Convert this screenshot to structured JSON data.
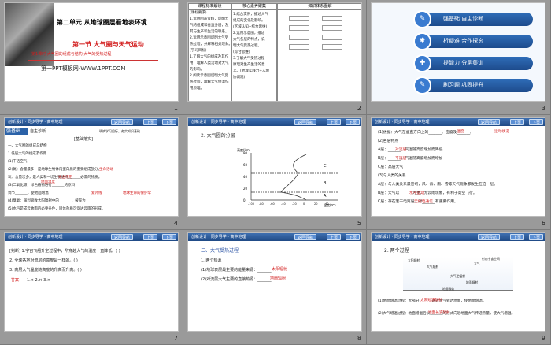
{
  "header": {
    "book": "创新设计 · 同步导学 · 高中地理",
    "nav": [
      "返回导航",
      "上页",
      "下页"
    ]
  },
  "slides": [
    {
      "num": "1",
      "unit": "第二单元  从地球圈层看地表环境",
      "section": "第一节  大气圈与天气运动",
      "lesson": "第1课时  大气圈的组成与结构  大气的受热过程",
      "site": "第一PPT模板网-WWW.1PPT.COM"
    },
    {
      "num": "2",
      "cols": [
        "课程标准解读",
        "核心素养聚集",
        "知识体系图解"
      ],
      "text1": [
        "(课标要求)",
        "1.运用图表资料，说明大",
        "气的组成和垂直分层，及",
        "其与生产和生活的联系。",
        "2.运用示意图说明大气受",
        "热过程，并解释相关现象。",
        "(学习目标)",
        "1.了解大气的组成及其作",
        "用，理解人类活动对大气",
        "的影响。",
        "2.阅读示意图说明大气受",
        "热过程，理解大气保温作",
        "用原理。"
      ],
      "text2": [
        "1.结合实例，描述大气",
        "组成的变化及影响。",
        "(区域认知+综合思维)",
        "2.运用示意图，描述",
        "大气各层的特点，说",
        "明大气受热过程。",
        "(综合思维)",
        "3.了解大气受热过程",
        "原理对生产生活的意",
        "义。(地理实践力+人地",
        "协调观)"
      ]
    },
    {
      "num": "3",
      "items": [
        "强基础 自主诊断",
        "析疑难 合作探究",
        "提能力 分层集训",
        "刷习题 巩固提升"
      ]
    },
    {
      "num": "4",
      "label": "强基础",
      "sub": "自主诊断",
      "note": "明辨学习目标，夯实知识基础",
      "heading": "[基础落实]",
      "lines": [
        "一、大气圈的组成与结构",
        "1.低层大气的组成及作用",
        "(1)干洁空气",
        "(2)氮：含量最多，是地球生物体内蛋白质的重要组成部分。",
        "氧：含量次多，是人类和一切生物维持_______必需的物质。",
        "(3)二氧化碳：绿色植物进行_______的原料",
        "     调节_______，使地面增温",
        "(4)臭氧：强烈吸收太阳辐射中的_______，被誉为_______",
        "(5)水汽是成云致雨的必要条件，固体杂质可促进云雨的形成。"
      ],
      "blanks": [
        "生命活动",
        "光合作用",
        "地面温度",
        "紫外线",
        "地球生命的保护伞"
      ]
    },
    {
      "num": "5",
      "title": "2. 大气圈的分层",
      "yl": "高度(km)",
      "xl": "温度(℃)",
      "labels": [
        "C",
        "B",
        "A"
      ],
      "yt": [
        "80",
        "60",
        "40",
        "20",
        "0"
      ],
      "xt": [
        "-100",
        "-80",
        "-60",
        "-40",
        "-20",
        "0",
        "20",
        "40"
      ]
    },
    {
      "num": "6",
      "lines": [
        "(1)依据：大气在垂直方向上的_______、密度及_______。",
        "(2)各层特点",
        "A层：_______，气温随高度增加而降低",
        "B层：_______，气温随高度增加而增加",
        "C层：高层大气",
        "(3)与人类的关系",
        "A层：与人类关系最密切，风、云、雨、雪等天气现象都发生在这一层。",
        "B层：大气以_______为主，无云雨现象，有利于高空飞行。",
        "C层：存在若干电离层，对_______有重要作用。"
      ],
      "blanks": [
        "温度",
        "运动状况",
        "对流层",
        "平流层",
        "水平运动",
        "无线电通信"
      ]
    },
    {
      "num": "7",
      "lines": [
        "[判断] 1.宇宙飞船升空过程中，所穿越大气的温度一直降低。( )",
        "2. 全球各地对流层的高度是一样的。( )",
        "3. 高层大气温度随高度的升高而升高。( )"
      ],
      "answer_label": "答案：",
      "answer": "1.×   2.×   3.×"
    },
    {
      "num": "8",
      "title": "二、大气受热过程",
      "s1": "1. 两个热源",
      "s2": "(1)地球表层最主要的能量来源：_______",
      "s3": "(2)对流层大气主要的直接热源：_______",
      "b1": "太阳辐射",
      "b2": "地面辐射"
    },
    {
      "num": "9",
      "title": "2. 两个过程",
      "diagram": [
        "太阳辐射",
        "大气辐射",
        "大气逆辐射",
        "地面辐射",
        "大气",
        "地面吸收",
        "射向宇宙空间"
      ],
      "l1": "(1)地面增温过程：大部分_______透过大气到达地面，使地面增温。",
      "l2": "(2)大气增温过程：地面增温后以_______的形式向近地面大气传递热量，使大气增温。",
      "b1": "太阳短波辐射",
      "b2": "地面长波辐射"
    }
  ]
}
